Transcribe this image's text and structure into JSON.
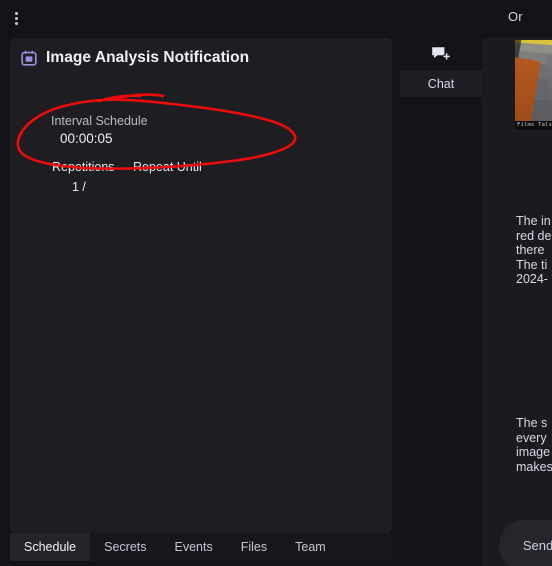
{
  "topbar": {
    "menu_icon": "kebab-menu-icon",
    "org_title": "Or"
  },
  "card": {
    "icon": "calendar-icon",
    "title": "Image Analysis Notification",
    "schedule": {
      "label": "Interval Schedule",
      "value": "00:00:05"
    },
    "repetitions": {
      "header": "Repetitions",
      "value": "1  /"
    },
    "repeat_until": {
      "header": "Repeat Until",
      "value": ""
    }
  },
  "tabs": [
    {
      "label": "Schedule",
      "active": true
    },
    {
      "label": "Secrets",
      "active": false
    },
    {
      "label": "Events",
      "active": false
    },
    {
      "label": "Files",
      "active": false
    },
    {
      "label": "Team",
      "active": false
    }
  ],
  "right_panel": {
    "new_chat_icon": "new-chat-icon",
    "chat_tab_label": "Chat",
    "attachment": {
      "caption": "Films Tals",
      "alt": "street-photo-thumbnail"
    },
    "messages": [
      "The in\nred de\nthere \nThe ti\n2024-",
      "The s\nevery \nimage\nmakes"
    ],
    "send_button_label": "Send"
  },
  "annotation": {
    "color": "#f00b0b",
    "shape": "hand-drawn-lasso-ellipse"
  },
  "colors": {
    "app_background": "#131317",
    "card_background": "#1d1d22",
    "tab_active_background": "#232329",
    "accent_icon": "#9a8fe0",
    "annotation_red": "#f00b0b"
  }
}
